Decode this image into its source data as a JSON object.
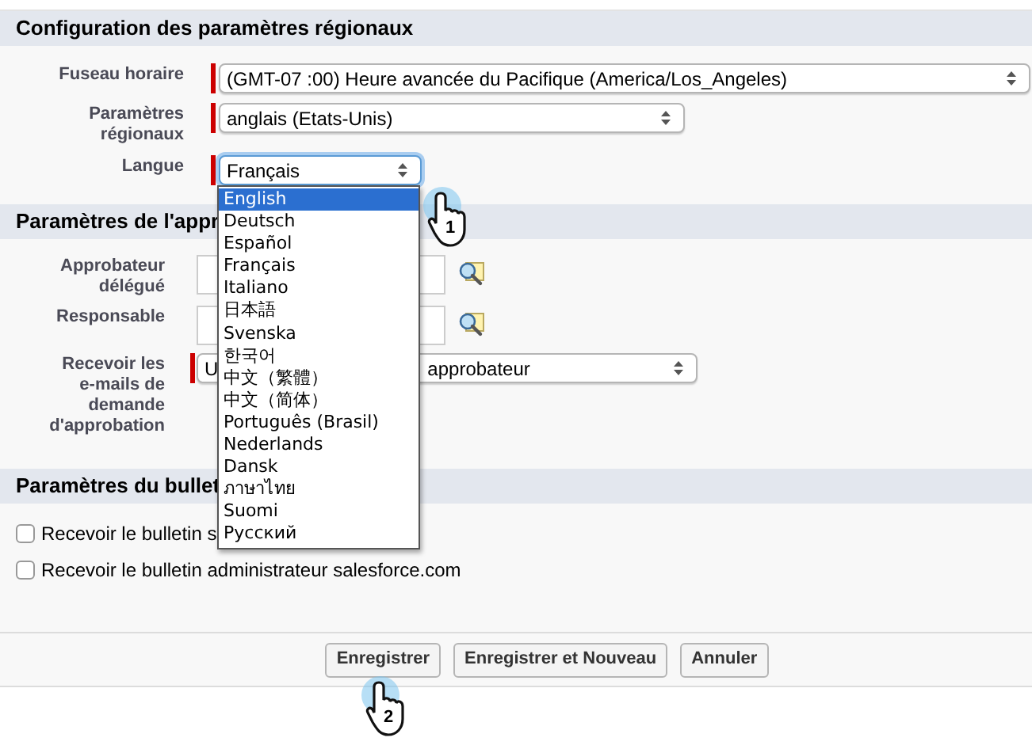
{
  "sections": [
    {
      "title": "Configuration des paramètres régionaux",
      "fields": [
        {
          "kind": "select",
          "label": "Fuseau horaire",
          "required": true,
          "value_parts": [
            "(GMT-07 :00) Heure avancée du Pacifique (America/Los_Angeles)"
          ],
          "focused": false
        },
        {
          "kind": "select",
          "label": "Paramètres régionaux",
          "required": true,
          "value_parts": [
            "anglais (Etats-Unis)"
          ],
          "focused": false
        },
        {
          "kind": "select",
          "label": "Langue",
          "required": true,
          "value_parts": [
            "Français"
          ],
          "focused": true
        }
      ]
    },
    {
      "title": "Paramètres de l'appr",
      "fields": [
        {
          "kind": "lookup",
          "label": "Approbateur délégué",
          "required": false
        },
        {
          "kind": "lookup",
          "label": "Responsable",
          "required": false
        },
        {
          "kind": "select",
          "label": "Recevoir les e-mails de demande d'approbation",
          "required": true,
          "value_parts": [
            "U",
            "approbateur"
          ],
          "focused": false
        }
      ]
    },
    {
      "title": "Paramètres du bullet",
      "fields": [
        {
          "kind": "checkbox",
          "label": "Recevoir le bulletin s",
          "checked": false
        },
        {
          "kind": "checkbox",
          "label": "Recevoir le bulletin administrateur salesforce.com",
          "checked": false
        }
      ]
    }
  ],
  "language_dropdown": {
    "options": [
      {
        "label": "English",
        "selected": true
      },
      {
        "label": "Deutsch",
        "selected": false
      },
      {
        "label": "Español",
        "selected": false
      },
      {
        "label": "Français",
        "selected": false
      },
      {
        "label": "Italiano",
        "selected": false
      },
      {
        "label": "日本語",
        "selected": false
      },
      {
        "label": "Svenska",
        "selected": false
      },
      {
        "label": "한국어",
        "selected": false
      },
      {
        "label": "中文（繁體）",
        "selected": false
      },
      {
        "label": "中文（简体）",
        "selected": false
      },
      {
        "label": "Português (Brasil)",
        "selected": false
      },
      {
        "label": "Nederlands",
        "selected": false
      },
      {
        "label": "Dansk",
        "selected": false
      },
      {
        "label": "ภาษาไทย",
        "selected": false
      },
      {
        "label": "Suomi",
        "selected": false
      },
      {
        "label": "Русский",
        "selected": false
      }
    ]
  },
  "buttons": [
    {
      "label": "Enregistrer"
    },
    {
      "label": "Enregistrer et Nouveau"
    },
    {
      "label": "Annuler"
    }
  ],
  "callouts": [
    {
      "number": "1"
    },
    {
      "number": "2"
    }
  ]
}
